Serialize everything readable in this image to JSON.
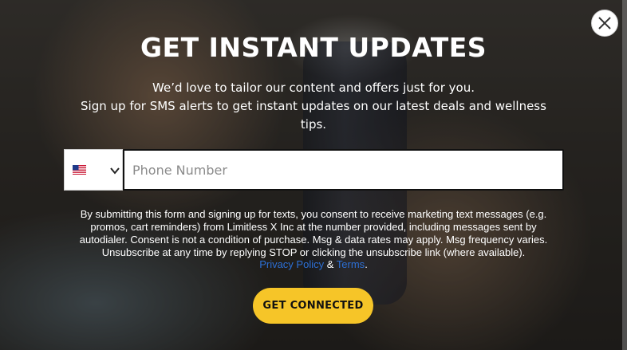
{
  "modal": {
    "title": "GET INSTANT UPDATES",
    "subtitle_line1": "We’d love to tailor our content and offers just for you.",
    "subtitle_line2": "Sign up for SMS alerts to get instant updates on our latest deals and wellness tips.",
    "close_icon": "close-icon"
  },
  "phone": {
    "country_flag": "us-flag-icon",
    "placeholder": "Phone Number",
    "value": ""
  },
  "consent": {
    "text": "By submitting this form and signing up for texts, you consent to receive marketing text messages (e.g. promos, cart reminders) from Limitless X Inc at the number provided, including messages sent by autodialer. Consent is not a condition of purchase. Msg & data rates may apply. Msg frequency varies. Unsubscribe at any time by replying STOP or clicking the unsubscribe link (where available).",
    "privacy_label": "Privacy Policy",
    "and_label": "&",
    "terms_label": "Terms",
    "period": "."
  },
  "cta": {
    "label": "GET CONNECTED"
  },
  "colors": {
    "button": "#f6c528",
    "link": "#2c6fd4",
    "text": "#ffffff"
  }
}
